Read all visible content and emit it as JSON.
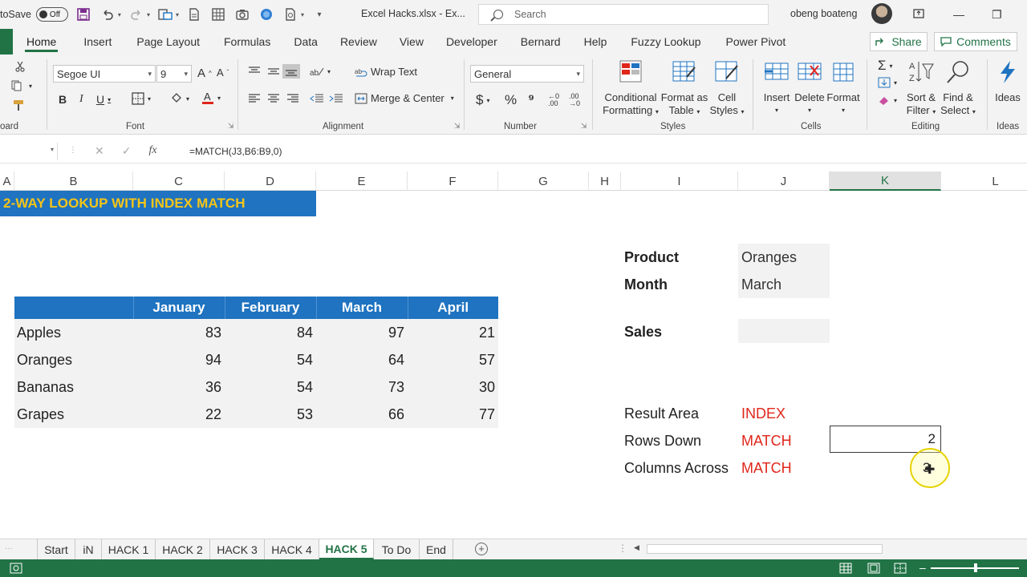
{
  "titlebar": {
    "autosave_label": "toSave",
    "autosave_state": "Off",
    "filename": "Excel Hacks.xlsx - Ex...",
    "search_placeholder": "Search",
    "user_name": "obeng boateng",
    "minimize": "—",
    "restore": "❐"
  },
  "ribbon_tabs": [
    "Home",
    "Insert",
    "Page Layout",
    "Formulas",
    "Data",
    "Review",
    "View",
    "Developer",
    "Bernard",
    "Help",
    "Fuzzy Lookup",
    "Power Pivot"
  ],
  "actions": {
    "share": "Share",
    "comments": "Comments"
  },
  "ribbon": {
    "font_name": "Segoe UI",
    "font_size": "9",
    "wrap_text": "Wrap Text",
    "merge_center": "Merge & Center",
    "number_format": "General",
    "groups": {
      "clipboard": "oard",
      "font": "Font",
      "alignment": "Alignment",
      "number": "Number",
      "styles": "Styles",
      "cells": "Cells",
      "editing": "Editing",
      "ideas": "Ideas"
    },
    "styles": {
      "conditional": "Conditional",
      "conditional2": "Formatting",
      "format_as": "Format as",
      "format_as2": "Table",
      "cell": "Cell",
      "cell2": "Styles"
    },
    "cells": {
      "insert": "Insert",
      "delete": "Delete",
      "format": "Format"
    },
    "editing": {
      "sort": "Sort &",
      "sort2": "Filter",
      "find": "Find &",
      "find2": "Select"
    },
    "ideas": "Ideas"
  },
  "formula_bar": {
    "fx": "fx",
    "formula": "=MATCH(J3,B6:B9,0)"
  },
  "columns": [
    "A",
    "B",
    "C",
    "D",
    "E",
    "F",
    "G",
    "H",
    "I",
    "J",
    "K",
    "L"
  ],
  "banner": "2-WAY LOOKUP WITH INDEX MATCH",
  "table": {
    "headers": [
      "",
      "January",
      "February",
      "March",
      "April"
    ],
    "rows": [
      {
        "label": "Apples",
        "values": [
          "83",
          "84",
          "97",
          "21"
        ]
      },
      {
        "label": "Oranges",
        "values": [
          "94",
          "54",
          "64",
          "57"
        ]
      },
      {
        "label": "Bananas",
        "values": [
          "36",
          "54",
          "73",
          "30"
        ]
      },
      {
        "label": "Grapes",
        "values": [
          "22",
          "53",
          "66",
          "77"
        ]
      }
    ]
  },
  "lookup": {
    "product_label": "Product",
    "product_value": "Oranges",
    "month_label": "Month",
    "month_value": "March",
    "sales_label": "Sales",
    "sales_value": ""
  },
  "explain": {
    "result_label": "Result Area",
    "result_fn": "INDEX",
    "rows_label": "Rows Down",
    "rows_fn": "MATCH",
    "rows_value": "2",
    "cols_label": "Columns Across",
    "cols_fn": "MATCH",
    "cols_value": "3"
  },
  "sheets": [
    "Start",
    "iN",
    "HACK 1",
    "HACK 2",
    "HACK 3",
    "HACK 4",
    "HACK 5",
    "To Do",
    "End"
  ],
  "active_sheet": "HACK 5",
  "colors": {
    "excel_green": "#217346",
    "header_blue": "#1f73c0",
    "banner_text": "#f5c518",
    "accent_red": "#e0261b"
  }
}
